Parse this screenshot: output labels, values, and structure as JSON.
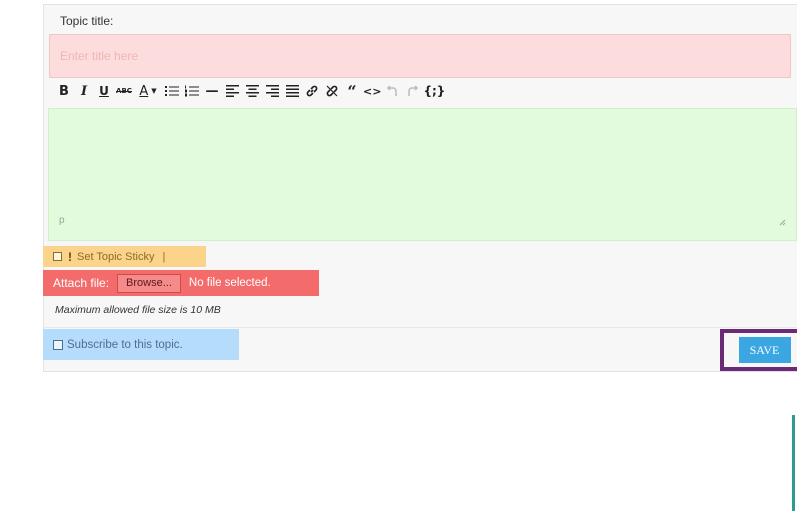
{
  "form": {
    "topic_label": "Topic title:",
    "title_placeholder": "Enter title here",
    "editor_path": "p"
  },
  "toolbar": {
    "buttons": [
      {
        "name": "bold",
        "glyph": "B"
      },
      {
        "name": "italic",
        "glyph": "I"
      },
      {
        "name": "underline",
        "glyph": "U"
      },
      {
        "name": "strikethrough",
        "glyph": "ABC"
      },
      {
        "name": "text-color",
        "glyph": "A"
      },
      {
        "name": "bullet-list",
        "glyph": "bullets"
      },
      {
        "name": "numbered-list",
        "glyph": "numbers"
      },
      {
        "name": "horizontal-rule",
        "glyph": "—"
      },
      {
        "name": "align-left",
        "glyph": "left"
      },
      {
        "name": "align-center",
        "glyph": "center"
      },
      {
        "name": "align-right",
        "glyph": "right"
      },
      {
        "name": "align-justify",
        "glyph": "justify"
      },
      {
        "name": "insert-link",
        "glyph": "link"
      },
      {
        "name": "remove-link",
        "glyph": "unlink"
      },
      {
        "name": "blockquote",
        "glyph": "“"
      },
      {
        "name": "code",
        "glyph": "<>"
      },
      {
        "name": "undo",
        "glyph": "undo"
      },
      {
        "name": "redo",
        "glyph": "redo"
      },
      {
        "name": "code-block",
        "glyph": "{;}"
      }
    ]
  },
  "sticky": {
    "label": "Set Topic Sticky",
    "separator": "|"
  },
  "attach": {
    "label": "Attach file:",
    "browse_label": "Browse...",
    "status": "No file selected."
  },
  "max_size_note": "Maximum allowed file size is 10 MB",
  "subscribe": {
    "label": "Subscribe to this topic."
  },
  "save_label": "SAVE",
  "colors": {
    "title_highlight": "#fcdcdc",
    "editor_highlight": "#e1fbdc",
    "sticky_highlight": "#fbd38a",
    "attach_highlight": "#f46b6b",
    "subscribe_highlight": "#b5dcfb",
    "save_button": "#3aa7e3",
    "save_frame": "#6a2a78"
  }
}
